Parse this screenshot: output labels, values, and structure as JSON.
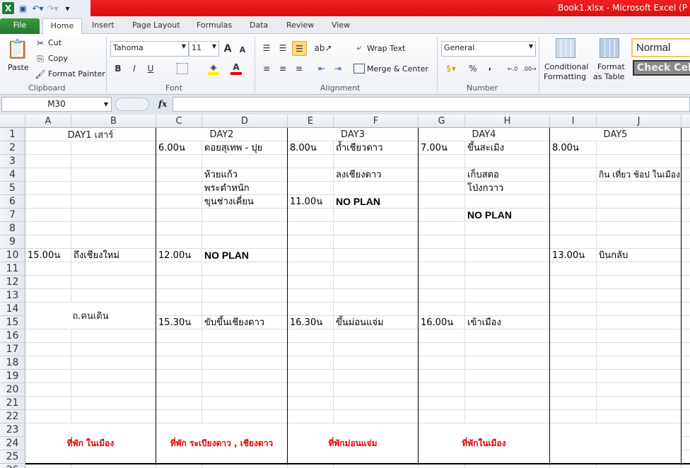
{
  "window": {
    "title": "Book1.xlsx  -  Microsoft Excel (P"
  },
  "tabs": [
    "File",
    "Home",
    "Insert",
    "Page Layout",
    "Formulas",
    "Data",
    "Review",
    "View"
  ],
  "clipboard": {
    "paste": "Paste",
    "cut": "Cut",
    "copy": "Copy",
    "format_painter": "Format Painter",
    "label": "Clipboard"
  },
  "font": {
    "name": "Tahoma",
    "size": "11",
    "label": "Font",
    "bold": "B",
    "italic": "I",
    "underline": "U"
  },
  "alignment": {
    "wrap": "Wrap Text",
    "merge": "Merge & Center",
    "label": "Alignment"
  },
  "number": {
    "format": "General",
    "percent": "%",
    "comma": ",",
    "label": "Number"
  },
  "styles": {
    "conditional1": "Conditional",
    "conditional2": "Formatting",
    "format1": "Format",
    "format2": "as Table",
    "normal": "Normal",
    "check": "Check Cell"
  },
  "formula_bar": {
    "name_box": "M30",
    "fx": "fx",
    "value": ""
  },
  "columns": [
    "A",
    "B",
    "C",
    "D",
    "E",
    "F",
    "G",
    "H",
    "I",
    "J"
  ],
  "rows": 25,
  "cells": [
    {
      "c": 0,
      "r": 2,
      "cs": 2,
      "rs": 1,
      "t": "DAY1 เสาร์"
    },
    {
      "c": 2,
      "r": 1,
      "cs": 2,
      "rs": 1,
      "t": "DAY2"
    },
    {
      "c": 4,
      "r": 1,
      "cs": 2,
      "rs": 1,
      "t": "DAY3"
    },
    {
      "c": 6,
      "r": 1,
      "cs": 2,
      "rs": 1,
      "t": "DAY4"
    },
    {
      "c": 8,
      "r": 1,
      "cs": 2,
      "rs": 1,
      "t": "DAY5"
    },
    {
      "c": 2,
      "r": 2,
      "t": "6.00น"
    },
    {
      "c": 3,
      "r": 2,
      "t": "ดอยสุเทพ - ปุย"
    },
    {
      "c": 4,
      "r": 2,
      "t": "8.00น"
    },
    {
      "c": 5,
      "r": 2,
      "t": "ถ้ำเชียวดาว"
    },
    {
      "c": 6,
      "r": 2,
      "t": "7.00น"
    },
    {
      "c": 7,
      "r": 2,
      "t": "ขึ้นสะเมิง"
    },
    {
      "c": 8,
      "r": 2,
      "t": "8.00น"
    },
    {
      "c": 3,
      "r": 4,
      "t": "ห้วยแก้ว"
    },
    {
      "c": 5,
      "r": 4,
      "t": "ลงเชียงดาว"
    },
    {
      "c": 7,
      "r": 4,
      "t": "เก็บสตอ"
    },
    {
      "c": 9,
      "r": 4,
      "t": "กิน เที่ยว ช้อป ในเมือง",
      "s": "small"
    },
    {
      "c": 3,
      "r": 5,
      "t": "พระตำหนัก"
    },
    {
      "c": 7,
      "r": 5,
      "t": "โป่งกวาว"
    },
    {
      "c": 3,
      "r": 6,
      "t": "ขุนช่างเคี่ยน"
    },
    {
      "c": 4,
      "r": 6,
      "t": "11.00น"
    },
    {
      "c": 5,
      "r": 6,
      "t": "NO PLAN",
      "s": "bold"
    },
    {
      "c": 7,
      "r": 7,
      "t": "NO PLAN",
      "s": "bold"
    },
    {
      "c": 0,
      "r": 10,
      "t": "15.00น"
    },
    {
      "c": 1,
      "r": 10,
      "t": " ถึงเชียงใหม่"
    },
    {
      "c": 2,
      "r": 10,
      "t": "12.00น"
    },
    {
      "c": 3,
      "r": 10,
      "t": "NO PLAN",
      "s": "bold"
    },
    {
      "c": 8,
      "r": 10,
      "t": "13.00น"
    },
    {
      "c": 9,
      "r": 10,
      "t": "บินกลับ"
    },
    {
      "c": 0,
      "r": 14,
      "cs": 2,
      "rs": 2,
      "t": "ถ.คนเดิน"
    },
    {
      "c": 2,
      "r": 15,
      "t": "15.30น"
    },
    {
      "c": 3,
      "r": 15,
      "t": "ขับขึ้นเชียงดาว"
    },
    {
      "c": 4,
      "r": 15,
      "t": "16.30น"
    },
    {
      "c": 5,
      "r": 15,
      "t": "ขึ้นม่อนแจ่ม"
    },
    {
      "c": 6,
      "r": 15,
      "t": "16.00น"
    },
    {
      "c": 7,
      "r": 15,
      "t": "เข้าเมือง"
    },
    {
      "c": 0,
      "r": 23,
      "cs": 2,
      "rs": 3,
      "t": "ที่พัก ในเมือง",
      "s": "red"
    },
    {
      "c": 2,
      "r": 23,
      "cs": 2,
      "rs": 3,
      "t": "ที่พัก ระเบียงดาว , เชียงดาว",
      "s": "red"
    },
    {
      "c": 4,
      "r": 23,
      "cs": 2,
      "rs": 3,
      "t": "ที่พักม่อนแจ่ม",
      "s": "red"
    },
    {
      "c": 6,
      "r": 23,
      "cs": 2,
      "rs": 3,
      "t": "ที่พักในเมือง",
      "s": "red"
    },
    {
      "c": 8,
      "r": 23,
      "cs": 2,
      "rs": 3,
      "t": ""
    }
  ]
}
